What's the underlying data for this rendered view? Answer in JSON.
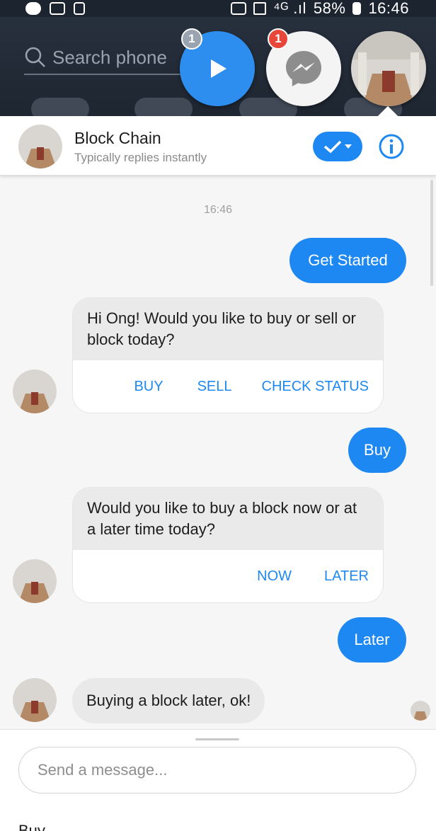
{
  "status_bar": {
    "battery": "58%",
    "time": "16:46"
  },
  "homescreen": {
    "search_placeholder": "Search phone"
  },
  "chat_heads": {
    "video_badge": "1",
    "messenger_badge": "1"
  },
  "header": {
    "name": "Block Chain",
    "subtitle": "Typically replies instantly"
  },
  "conversation": {
    "timestamp": "16:46",
    "messages": [
      {
        "text": "Get Started"
      },
      {
        "text": "Hi Ong! Would you like to buy or sell or block today?",
        "buttons": [
          "BUY",
          "SELL",
          "CHECK STATUS"
        ]
      },
      {
        "text": "Buy"
      },
      {
        "text": "Would you like to buy a block now or at a later time today?",
        "buttons": [
          "NOW",
          "LATER"
        ]
      },
      {
        "text": "Later"
      },
      {
        "text": "Buying a block later, ok!"
      }
    ]
  },
  "composer": {
    "placeholder": "Send a message...",
    "quick_reply": "Buy"
  },
  "colors": {
    "accent": "#1e88f2",
    "incoming_bubble": "#e9e9e9",
    "panel_bg": "#f6f6f6"
  }
}
